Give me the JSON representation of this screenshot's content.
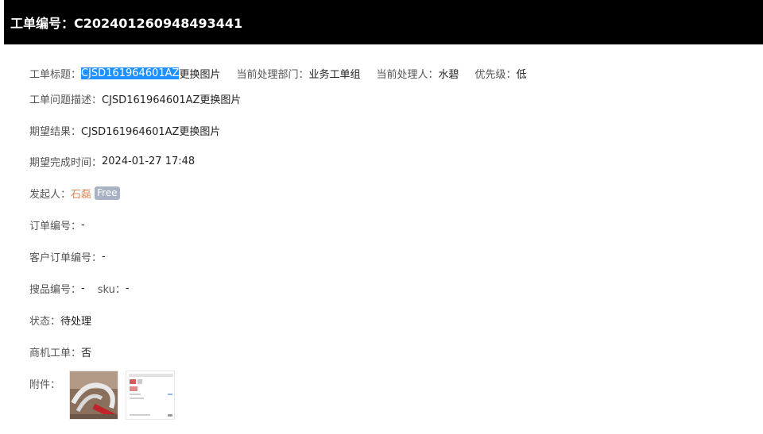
{
  "header": {
    "title": "工单编号：C202401260948493441"
  },
  "summary": {
    "title_label": "工单标题：",
    "title_highlight": "CJSD161964601AZ",
    "title_rest": "更换图片",
    "dept_label": "当前处理部门：",
    "dept_value": "业务工单组",
    "handler_label": "当前处理人：",
    "handler_value": "水碧",
    "priority_label": "优先级：",
    "priority_value": "低"
  },
  "fields": {
    "description_label": "工单问题描述：",
    "description_value": "CJSD161964601AZ更换图片",
    "expected_result_label": "期望结果：",
    "expected_result_value": "CJSD161964601AZ更换图片",
    "expected_time_label": "期望完成时间：",
    "expected_time_value": "2024-01-27 17:48",
    "initiator_label": "发起人：",
    "initiator_name": "石磊",
    "initiator_badge": "Free",
    "order_no_label": "订单编号：",
    "order_no_value": "-",
    "customer_order_label": "客户订单编号：",
    "customer_order_value": "-",
    "sourcing_no_label": "搜品编号：",
    "sourcing_no_value": "-",
    "sku_label": "sku：",
    "sku_value": "-",
    "status_label": "状态：",
    "status_value": "待处理",
    "opportunity_label": "商机工单：",
    "opportunity_value": "否",
    "attachments_label": "附件："
  },
  "attachments": [
    {
      "icon": "photo-thumbnail"
    },
    {
      "icon": "screenshot-thumbnail"
    }
  ],
  "colors": {
    "header_bg": "#000000",
    "highlight_bg": "#1e90ff",
    "initiator_color": "#d88a5c",
    "badge_bg": "#a9b3c4"
  }
}
